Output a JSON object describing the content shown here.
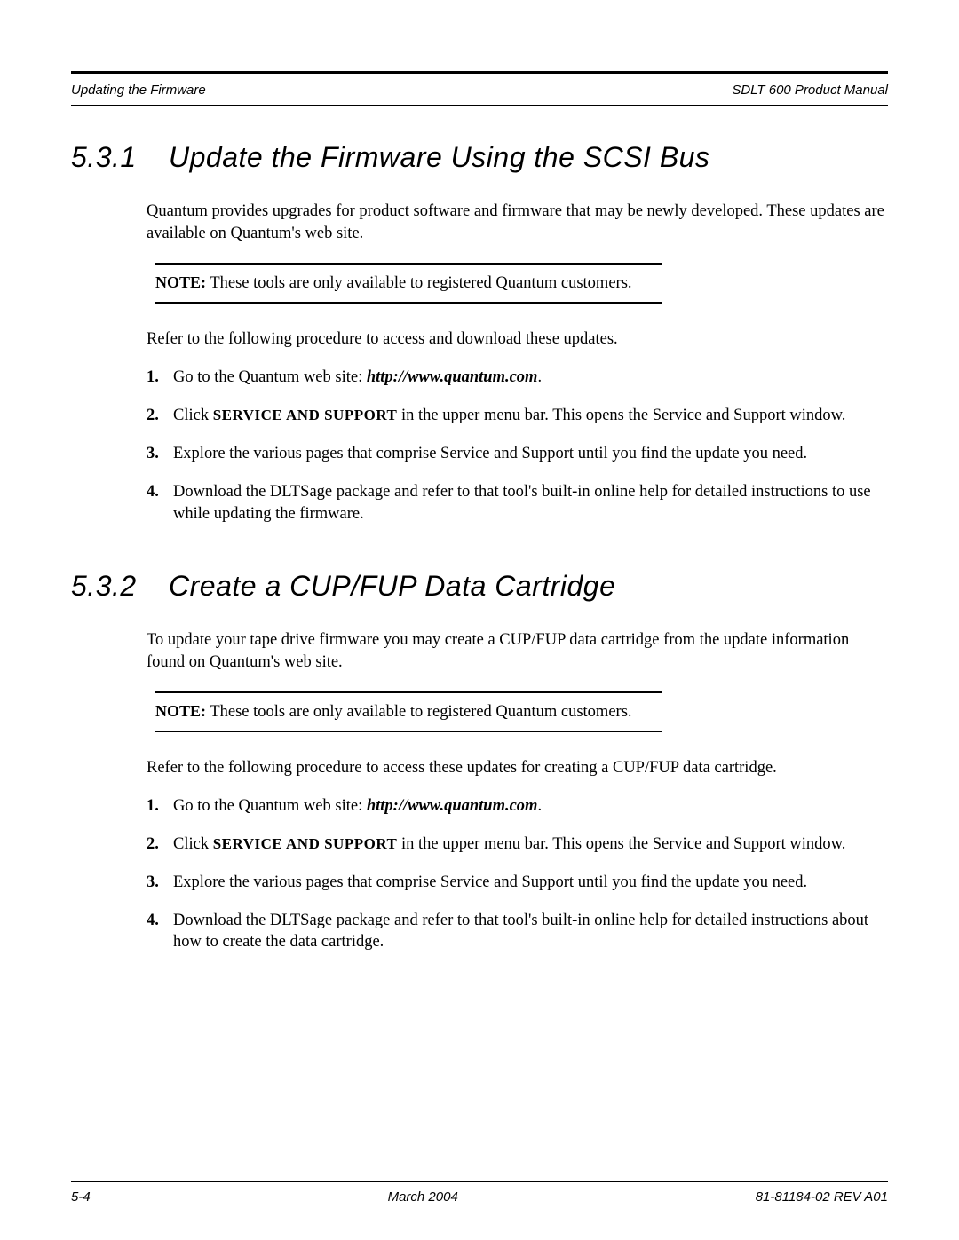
{
  "header": {
    "left": "Updating the Firmware",
    "right": "SDLT 600 Product Manual"
  },
  "section1": {
    "number": "5.3.1",
    "title": "Update the Firmware Using the SCSI Bus",
    "intro": "Quantum provides upgrades for product software and firmware that may be newly developed. These updates are available on Quantum's web site.",
    "note_label": "NOTE:",
    "note_text": "These tools are only available to registered Quantum customers.",
    "after_note": "Refer to the following procedure to access and download these updates.",
    "steps": {
      "s1a": "Go to the Quantum web site: ",
      "s1b": "http://www.quantum.com",
      "s1c": ".",
      "s2a": "Click ",
      "s2b": "SERVICE AND SUPPORT",
      "s2c": " in the upper menu bar. This opens the Service and Support window.",
      "s3": "Explore the various pages that comprise Service and Support until you find the update you need.",
      "s4": "Download the DLTSage package and refer to that tool's built-in online help for detailed instructions to use while updating the firmware."
    }
  },
  "section2": {
    "number": "5.3.2",
    "title": "Create a CUP/FUP Data Cartridge",
    "intro": "To update your tape drive firmware you may create a CUP/FUP data cartridge from the update information found on Quantum's web site.",
    "note_label": "NOTE:",
    "note_text": "These tools are only available to registered Quantum customers.",
    "after_note": "Refer to the following procedure to access these updates for creating a CUP/FUP data cartridge.",
    "steps": {
      "s1a": "Go to the Quantum web site: ",
      "s1b": "http://www.quantum.com",
      "s1c": ".",
      "s2a": "Click ",
      "s2b": "SERVICE AND SUPPORT",
      "s2c": " in the upper menu bar. This opens the Service and Support window.",
      "s3": "Explore the various pages that comprise Service and Support until you find the update you need.",
      "s4": "Download the DLTSage package and refer to that tool's built-in online help for detailed instructions about how to create the data cartridge."
    }
  },
  "footer": {
    "left": "5-4",
    "center": "March 2004",
    "right": "81-81184-02 REV A01"
  }
}
